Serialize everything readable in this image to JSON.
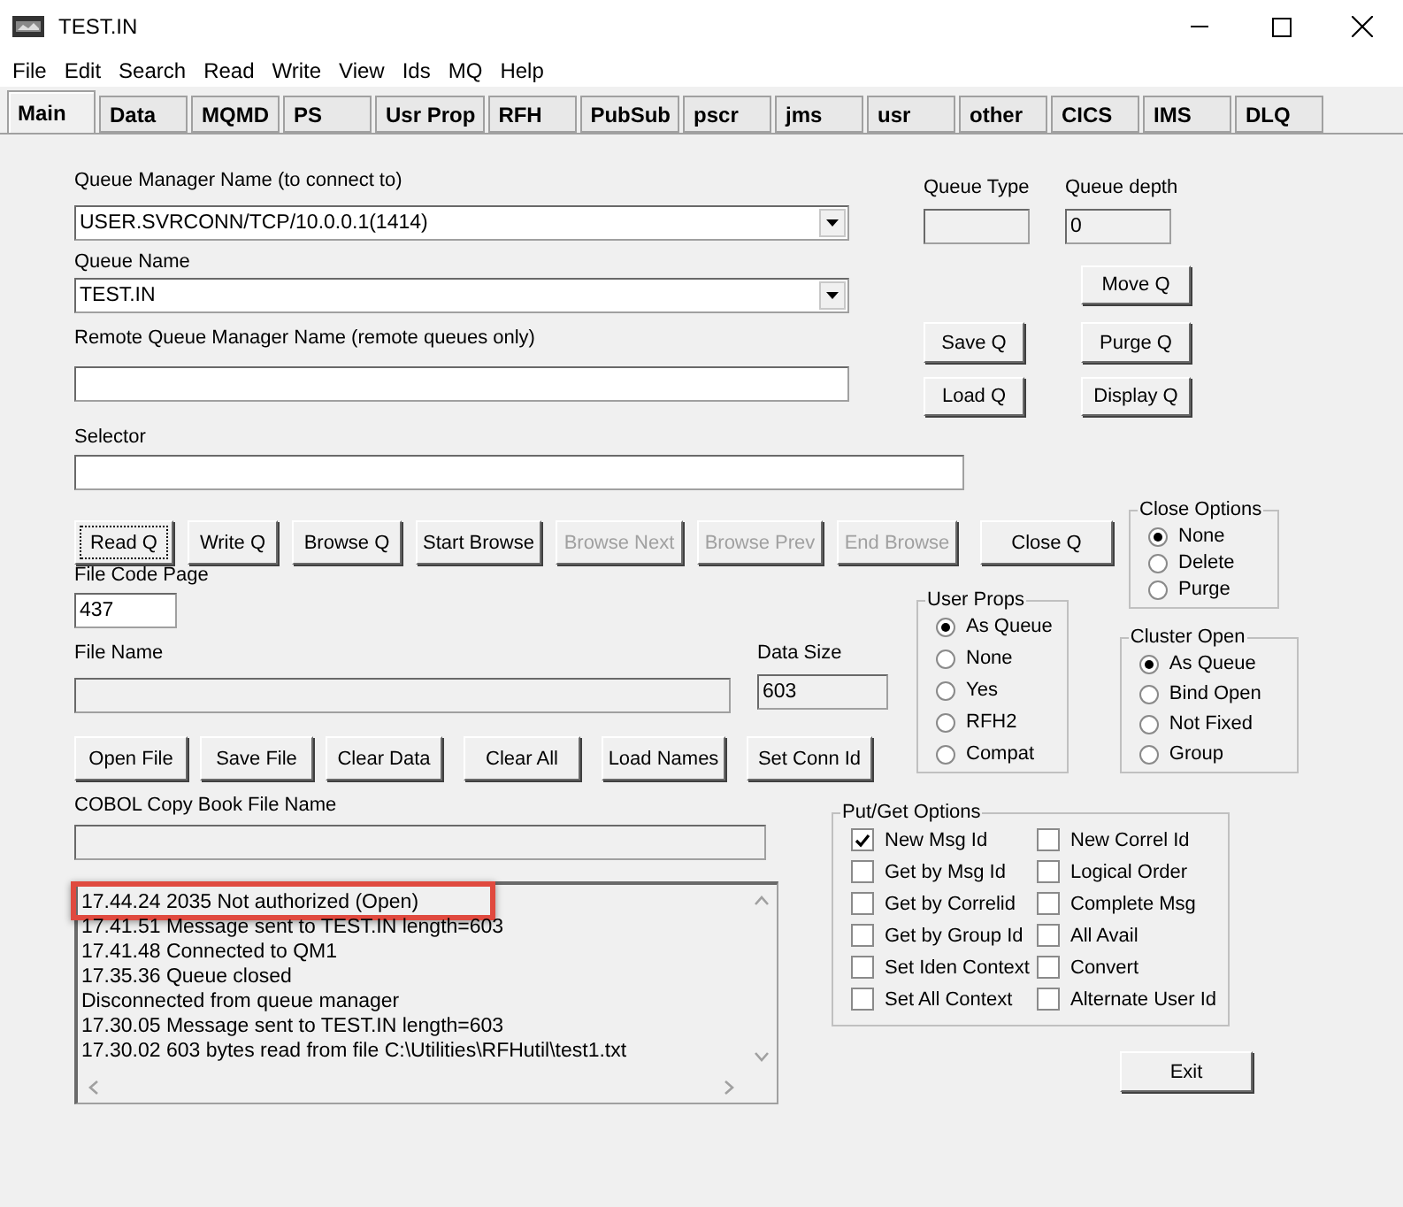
{
  "window": {
    "title": "TEST.IN"
  },
  "menu": [
    "File",
    "Edit",
    "Search",
    "Read",
    "Write",
    "View",
    "Ids",
    "MQ",
    "Help"
  ],
  "tabs": [
    {
      "label": "Main",
      "selected": true
    },
    {
      "label": "Data",
      "selected": false
    },
    {
      "label": "MQMD",
      "selected": false
    },
    {
      "label": "PS",
      "selected": false
    },
    {
      "label": "Usr Prop",
      "selected": false
    },
    {
      "label": "RFH",
      "selected": false
    },
    {
      "label": "PubSub",
      "selected": false
    },
    {
      "label": "pscr",
      "selected": false
    },
    {
      "label": "jms",
      "selected": false
    },
    {
      "label": "usr",
      "selected": false
    },
    {
      "label": "other",
      "selected": false
    },
    {
      "label": "CICS",
      "selected": false
    },
    {
      "label": "IMS",
      "selected": false
    },
    {
      "label": "DLQ",
      "selected": false
    }
  ],
  "queue_manager": {
    "label": "Queue Manager Name (to connect to)",
    "value": "USER.SVRCONN/TCP/10.0.0.1(1414)"
  },
  "queue_name": {
    "label": "Queue Name",
    "value": "TEST.IN"
  },
  "remote_queue_manager": {
    "label": "Remote Queue Manager Name (remote queues only)"
  },
  "queue_type": {
    "label": "Queue Type"
  },
  "queue_depth": {
    "label": "Queue depth",
    "value": "0"
  },
  "queue_buttons": [
    {
      "label": "Move Q"
    },
    {
      "label": "Save Q"
    },
    {
      "label": "Purge Q"
    },
    {
      "label": "Load Q"
    },
    {
      "label": "Display Q"
    }
  ],
  "selector": {
    "label": "Selector"
  },
  "action_buttons": [
    {
      "label": "Read Q",
      "disabled": false,
      "focused": true
    },
    {
      "label": "Write Q",
      "disabled": false,
      "focused": false
    },
    {
      "label": "Browse Q",
      "disabled": false,
      "focused": false
    },
    {
      "label": "Start Browse",
      "disabled": false,
      "focused": false
    },
    {
      "label": "Browse Next",
      "disabled": true,
      "focused": false
    },
    {
      "label": "Browse Prev",
      "disabled": true,
      "focused": false
    },
    {
      "label": "End Browse",
      "disabled": true,
      "focused": false
    },
    {
      "label": "Close Q",
      "disabled": false,
      "focused": false
    }
  ],
  "close_options": {
    "title": "Close Options",
    "options": [
      {
        "label": "None",
        "selected": true
      },
      {
        "label": "Delete",
        "selected": false
      },
      {
        "label": "Purge",
        "selected": false
      }
    ]
  },
  "file_code_page": {
    "label": "File Code Page",
    "value": "437"
  },
  "file_name": {
    "label": "File Name"
  },
  "data_size": {
    "label": "Data Size",
    "value": "603"
  },
  "file_buttons": [
    {
      "label": "Open File"
    },
    {
      "label": "Save File"
    },
    {
      "label": "Clear Data"
    },
    {
      "label": "Clear All"
    },
    {
      "label": "Load Names"
    },
    {
      "label": "Set Conn Id"
    }
  ],
  "user_props": {
    "title": "User Props",
    "options": [
      {
        "label": "As Queue",
        "selected": true
      },
      {
        "label": "None",
        "selected": false
      },
      {
        "label": "Yes",
        "selected": false
      },
      {
        "label": "RFH2",
        "selected": false
      },
      {
        "label": "Compat",
        "selected": false
      }
    ]
  },
  "cluster_open": {
    "title": "Cluster Open",
    "options": [
      {
        "label": "As Queue",
        "selected": true
      },
      {
        "label": "Bind Open",
        "selected": false
      },
      {
        "label": "Not Fixed",
        "selected": false
      },
      {
        "label": "Group",
        "selected": false
      }
    ]
  },
  "cobol_copy_book": {
    "label": "COBOL Copy Book File Name"
  },
  "log": [
    {
      "text": "17.44.24 2035 Not authorized (Open)",
      "highlighted": true
    },
    {
      "text": "17.41.51 Message sent to TEST.IN length=603",
      "highlighted": false
    },
    {
      "text": "17.41.48 Connected to QM1",
      "highlighted": false
    },
    {
      "text": "17.35.36 Queue closed",
      "highlighted": false
    },
    {
      "text": "Disconnected from queue manager",
      "highlighted": false
    },
    {
      "text": "17.30.05 Message sent to TEST.IN length=603",
      "highlighted": false
    },
    {
      "text": "17.30.02 603 bytes read from file C:\\Utilities\\RFHutil\\test1.txt",
      "highlighted": false
    }
  ],
  "put_get_options": {
    "title": "Put/Get Options",
    "options": [
      {
        "label": "New Msg Id",
        "checked": true
      },
      {
        "label": "New Correl Id",
        "checked": false
      },
      {
        "label": "Get by Msg Id",
        "checked": false
      },
      {
        "label": "Logical Order",
        "checked": false
      },
      {
        "label": "Get by Correlid",
        "checked": false
      },
      {
        "label": "Complete Msg",
        "checked": false
      },
      {
        "label": "Get by Group Id",
        "checked": false
      },
      {
        "label": "All Avail",
        "checked": false
      },
      {
        "label": "Set Iden Context",
        "checked": false
      },
      {
        "label": "Convert",
        "checked": false
      },
      {
        "label": "Set All Context",
        "checked": false
      },
      {
        "label": "Alternate User Id",
        "checked": false
      }
    ]
  },
  "exit_button": {
    "label": "Exit"
  }
}
